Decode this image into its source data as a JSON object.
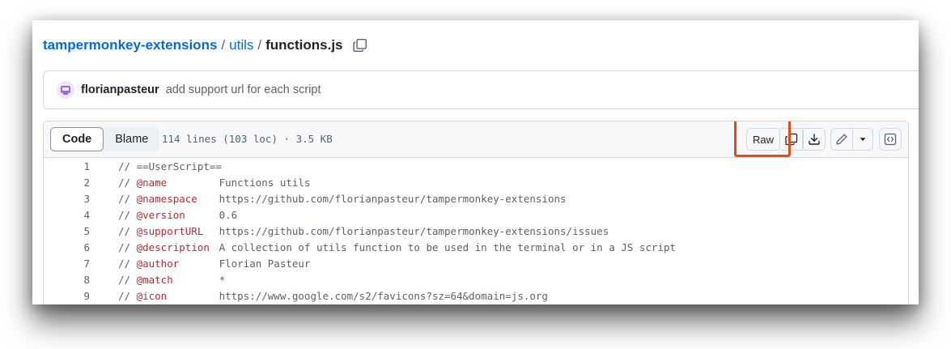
{
  "breadcrumb": {
    "repo": "tampermonkey-extensions",
    "separator": "/",
    "folder": "utils",
    "file": "functions.js"
  },
  "commit": {
    "author": "florianpasteur",
    "message": "add support url for each script"
  },
  "file_header": {
    "tabs": [
      {
        "label": "Code",
        "active": true
      },
      {
        "label": "Blame",
        "active": false
      }
    ],
    "meta": "114 lines (103 loc) · 3.5 KB",
    "raw_label": "Raw"
  },
  "code_lines": [
    {
      "num": "1",
      "prefix": "// ==UserScript==",
      "tag": "",
      "value": ""
    },
    {
      "num": "2",
      "prefix": "// ",
      "tag": "@name",
      "value": "Functions utils"
    },
    {
      "num": "3",
      "prefix": "// ",
      "tag": "@namespace",
      "value": "https://github.com/florianpasteur/tampermonkey-extensions"
    },
    {
      "num": "4",
      "prefix": "// ",
      "tag": "@version",
      "value": "0.6"
    },
    {
      "num": "5",
      "prefix": "// ",
      "tag": "@supportURL",
      "value": "https://github.com/florianpasteur/tampermonkey-extensions/issues"
    },
    {
      "num": "6",
      "prefix": "// ",
      "tag": "@description",
      "value": "A collection of utils function to be used in the terminal or in a JS script"
    },
    {
      "num": "7",
      "prefix": "// ",
      "tag": "@author",
      "value": "Florian Pasteur"
    },
    {
      "num": "8",
      "prefix": "// ",
      "tag": "@match",
      "value": "*"
    },
    {
      "num": "9",
      "prefix": "// ",
      "tag": "@icon",
      "value": "https://www.google.com/s2/favicons?sz=64&domain=js.org"
    }
  ],
  "colors": {
    "link": "#0969da",
    "annotation_tag": "#cf222e",
    "highlight": "#e8481c"
  },
  "icons": [
    "copy-icon",
    "download-icon",
    "pencil-icon",
    "triangle-down-icon",
    "code-square-icon",
    "avatar-icon"
  ]
}
